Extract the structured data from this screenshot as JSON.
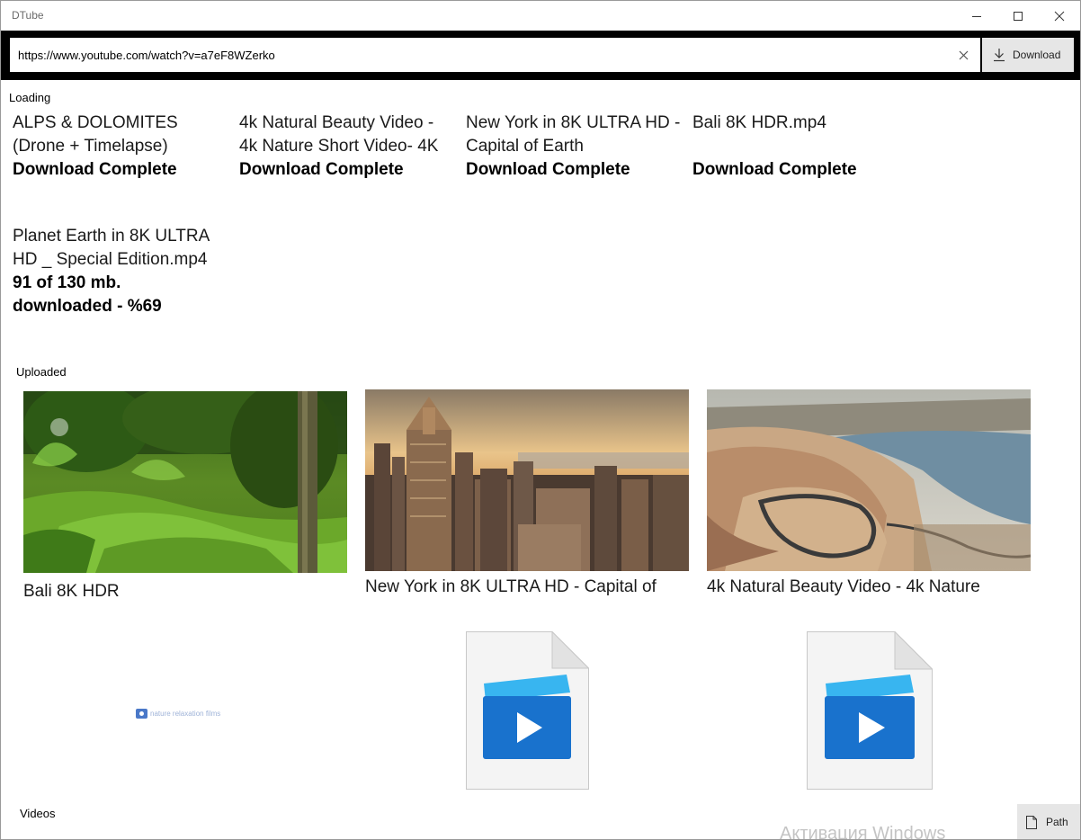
{
  "window": {
    "title": "DTube"
  },
  "urlbar": {
    "url_value": "https://www.youtube.com/watch?v=a7eF8WZerko",
    "download_label": "Download"
  },
  "sections": {
    "loading": "Loading",
    "uploaded": "Uploaded",
    "videos": "Videos"
  },
  "loading_items": [
    {
      "title": "ALPS & DOLOMITES (Drone + Timelapse)",
      "status": "Download Complete"
    },
    {
      "title": "4k Natural Beauty Video - 4k Nature Short Video- 4K",
      "status": "Download Complete"
    },
    {
      "title": "New York in 8K ULTRA HD - Capital of Earth",
      "status": "Download Complete"
    },
    {
      "title": "Bali 8K HDR.mp4",
      "status": "Download Complete"
    },
    {
      "title": "Planet Earth in 8K ULTRA HD _ Special Edition.mp4",
      "status": "91 of 130 mb. downloaded - %69"
    }
  ],
  "uploaded_items": [
    {
      "caption": "Bali 8K HDR",
      "thumb": "jungle-rice-terrace"
    },
    {
      "caption": "New York in 8K ULTRA HD - Capital of",
      "thumb": "city-skyline-sunset"
    },
    {
      "caption": "4k Natural Beauty Video - 4k Nature",
      "thumb": "river-gorge-road"
    }
  ],
  "small_watermark": "nature relaxation films",
  "footer": {
    "path_label": "Path",
    "activation_text": "Активация Windows"
  },
  "colors": {
    "url_bar_bg": "#000000",
    "button_bg": "#e6e6e6",
    "video_icon_blue": "#1f7ed6"
  }
}
